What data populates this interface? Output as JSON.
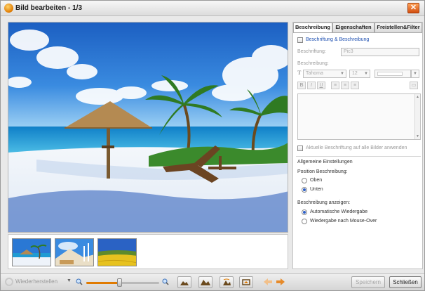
{
  "window": {
    "title": "Bild bearbeiten - 1/3",
    "close_label": "✕"
  },
  "tabs": [
    {
      "label": "Beschreibung",
      "active": true
    },
    {
      "label": "Eigenschaften",
      "active": false
    },
    {
      "label": "Freistellen&Filter",
      "active": false
    }
  ],
  "caption": {
    "checkbox_label": "Beschriftung & Beschreibung",
    "checked": false,
    "caption_label": "Beschriftung:",
    "caption_value": "Pic3",
    "description_label": "Beschreibung:",
    "font_value": "Tahoma",
    "size_value": "12",
    "format_buttons": [
      "B",
      "I",
      "U"
    ],
    "apply_all_label": "Aktuelle Beschriftung auf alle Bilder anwenden"
  },
  "general": {
    "heading": "Allgemeine Einstellungen",
    "position_label": "Position Beschreibung:",
    "position_options": [
      {
        "label": "Oben",
        "selected": false
      },
      {
        "label": "Unten",
        "selected": true
      }
    ],
    "display_label": "Beschreibung anzeigen:",
    "display_options": [
      {
        "label": "Automatische Wiedergabe",
        "selected": true
      },
      {
        "label": "Wiedergabe nach Mouse-Over",
        "selected": false
      }
    ]
  },
  "toolbar": {
    "reset_label": "Wiederherstellen",
    "zoom_level": 0.45,
    "save_label": "Speichern",
    "close_label": "Schließen"
  },
  "colors": {
    "accent": "#e07a00",
    "link_blue": "#1c4eb0",
    "sky": "#2a78d4",
    "sea": "#1f9bd4"
  }
}
